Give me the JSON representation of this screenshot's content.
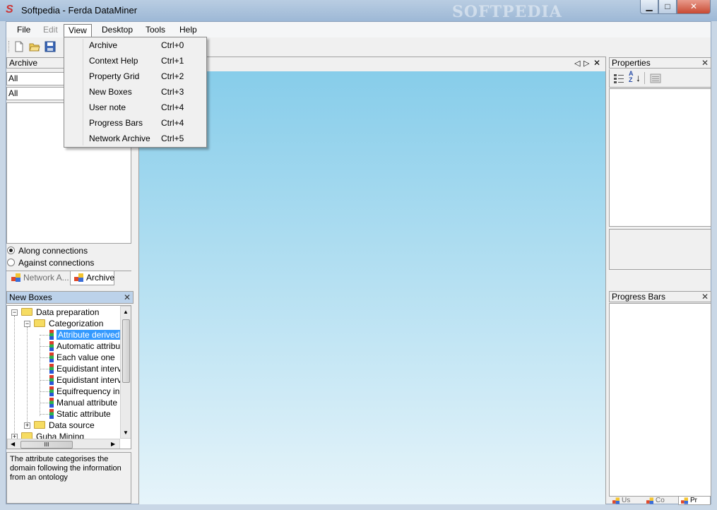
{
  "window": {
    "title": "Softpedia - Ferda DataMiner",
    "watermark": "SOFTPEDIA",
    "min": "▁",
    "max": "□",
    "close": "✕"
  },
  "menubar": [
    "File",
    "Edit",
    "View",
    "Desktop",
    "Tools",
    "Help"
  ],
  "view_menu": [
    {
      "label": "Archive",
      "shortcut": "Ctrl+0"
    },
    {
      "label": "Context Help",
      "shortcut": "Ctrl+1"
    },
    {
      "label": "Property Grid",
      "shortcut": "Ctrl+2"
    },
    {
      "label": "New Boxes",
      "shortcut": "Ctrl+3"
    },
    {
      "label": "User note",
      "shortcut": "Ctrl+4"
    },
    {
      "label": "Progress Bars",
      "shortcut": "Ctrl+4"
    },
    {
      "label": "Network Archive",
      "shortcut": "Ctrl+5"
    }
  ],
  "archive_panel": {
    "title": "Archive",
    "filter1": "All",
    "filter2": "All",
    "radio1": "Along connections",
    "radio2": "Against connections",
    "tab1": "Network A...",
    "tab2": "Archive"
  },
  "new_boxes_panel": {
    "title": "New Boxes",
    "close": "✕",
    "tree": {
      "root1": "Data preparation",
      "child1": "Categorization",
      "leaves": [
        "Attribute derived",
        "Automatic attribu",
        "Each value one",
        "Equidistant interv",
        "Equidistant interv",
        "Equifrequency in",
        "Manual attribute",
        "Static attribute"
      ],
      "child2": "Data source",
      "root2": "Guha Mining"
    },
    "hscroll_label": "III",
    "description": "The attribute categorises the domain following the information from an ontology"
  },
  "properties_panel": {
    "title": "Properties",
    "close": "✕",
    "sort_label": "A Z"
  },
  "progress_panel": {
    "title": "Progress Bars",
    "close": "✕",
    "tabs": [
      "Us",
      "Co",
      "Pr"
    ]
  },
  "doc_tabs": {
    "nav_prev": "◁",
    "nav_next": "▷",
    "close": "✕"
  },
  "colors": {
    "canvas_top": "#87cdea",
    "canvas_bottom": "#e6f4fa",
    "selection": "#3399ff",
    "panel_active": "#bcd2ea"
  },
  "icons": [
    "new-file-icon",
    "open-folder-icon",
    "save-icon",
    "categorized-icon",
    "alphabetical-sort-icon",
    "property-pages-icon"
  ]
}
